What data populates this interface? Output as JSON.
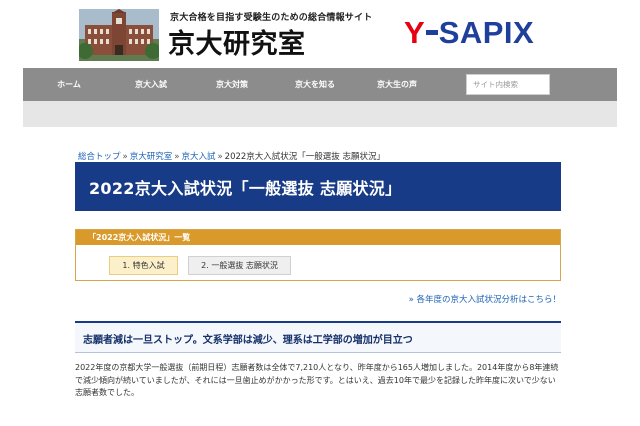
{
  "header": {
    "tagline": "京大合格を目指す受験生のための総合情報サイト",
    "site_name": "京大研究室",
    "brand_y": "Y",
    "brand_rest": "SAPIX",
    "brand_colors": {
      "red": "#e60012",
      "blue": "#1f3f9d"
    }
  },
  "nav": {
    "items": [
      {
        "label": "ホーム"
      },
      {
        "label": "京大入試"
      },
      {
        "label": "京大対策"
      },
      {
        "label": "京大を知る"
      },
      {
        "label": "京大生の声"
      }
    ],
    "search_placeholder": "サイト内検索"
  },
  "breadcrumb": {
    "items": [
      "総合トップ",
      "京大研究室",
      "京大入試"
    ],
    "separator": "»",
    "current": "2022京大入試状況「一般選抜 志願状況」"
  },
  "page_title": "2022京大入試状況「一般選抜 志願状況」",
  "toc": {
    "header": "「2022京大入試状況」一覧",
    "items": [
      {
        "label": "1. 特色入試",
        "active": true
      },
      {
        "label": "2. 一般選抜 志願状況",
        "active": false
      }
    ]
  },
  "more_link": "» 各年度の京大入試状況分析はこちら！",
  "section_heading": "志願者減は一旦ストップ。文系学部は減少、理系は工学部の増加が目立つ",
  "body_text": "2022年度の京都大学一般選抜（前期日程）志願者数は全体で7,210人となり、昨年度から165人増加しました。2014年度から8年連続で減少傾向が続いていましたが、それには一旦歯止めがかかった形です。とはいえ、過去10年で最少を記録した昨年度に次いで少ない志願者数でした。",
  "colors": {
    "nav_bg": "#8c8c8c",
    "title_bg": "#173b86",
    "toc_accent": "#d99a2b",
    "link": "#1a62b5"
  }
}
